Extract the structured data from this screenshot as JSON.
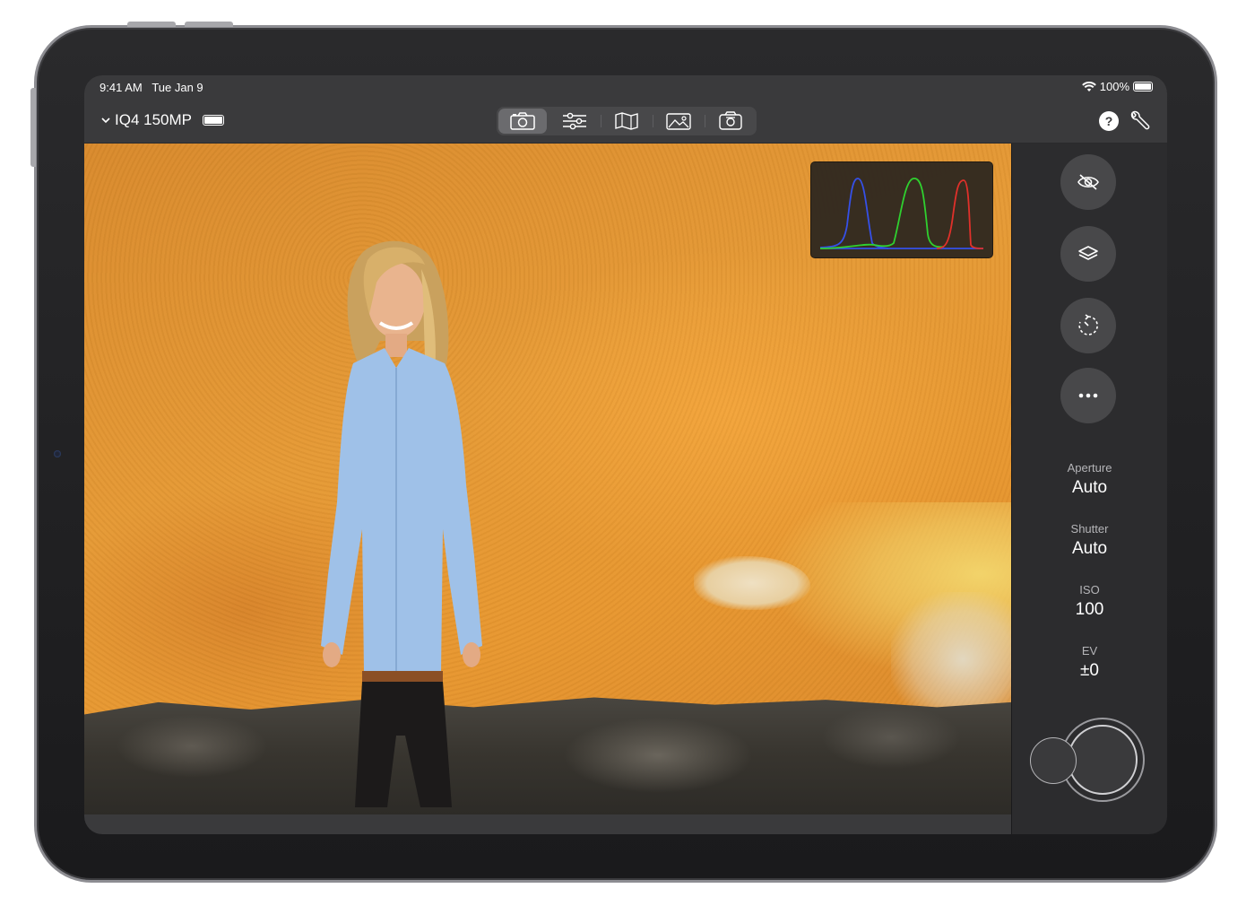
{
  "status": {
    "time": "9:41 AM",
    "date": "Tue Jan 9",
    "battery_pct": "100%"
  },
  "toolbar": {
    "camera_name": "IQ4 150MP",
    "tabs": [
      {
        "id": "capture",
        "icon": "camera-icon",
        "active": true
      },
      {
        "id": "adjust",
        "icon": "sliders-icon",
        "active": false
      },
      {
        "id": "map",
        "icon": "map-icon",
        "active": false
      },
      {
        "id": "gallery",
        "icon": "photos-icon",
        "active": false
      },
      {
        "id": "camera-settings",
        "icon": "camera-body-icon",
        "active": false
      }
    ],
    "help_label": "?"
  },
  "sidebar": {
    "buttons": [
      {
        "id": "visibility",
        "icon": "eye-slash-icon"
      },
      {
        "id": "layers",
        "icon": "layers-icon"
      },
      {
        "id": "timer",
        "icon": "timer-icon"
      },
      {
        "id": "more",
        "icon": "ellipsis-icon"
      }
    ],
    "params": [
      {
        "label": "Aperture",
        "value": "Auto"
      },
      {
        "label": "Shutter",
        "value": "Auto"
      },
      {
        "label": "ISO",
        "value": "100"
      },
      {
        "label": "EV",
        "value": "±0"
      }
    ]
  },
  "colors": {
    "chrome": "#3a3a3c",
    "sidebar": "#2c2c2e",
    "hist_red": "#e0302a",
    "hist_green": "#2fd02f",
    "hist_blue": "#3550e8"
  }
}
